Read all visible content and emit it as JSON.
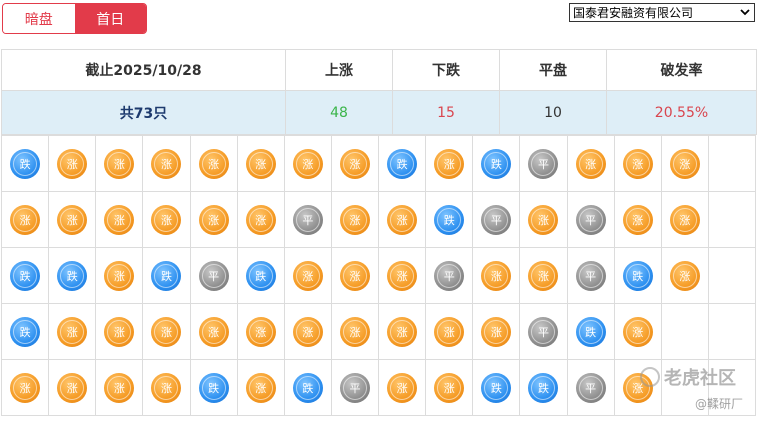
{
  "tabs": [
    {
      "label": "暗盘",
      "active": false
    },
    {
      "label": "首日",
      "active": true
    }
  ],
  "broker_select": {
    "selected": "国泰君安融资有限公司"
  },
  "summary": {
    "headers": [
      "截止2025/10/28",
      "上涨",
      "下跌",
      "平盘",
      "破发率"
    ],
    "total": "共73只",
    "up": "48",
    "down": "15",
    "flat": "10",
    "rate": "20.55%"
  },
  "coin_labels": {
    "up": "涨",
    "down": "跌",
    "flat": "平"
  },
  "grid": [
    [
      "down",
      "up",
      "up",
      "up",
      "up",
      "up",
      "up",
      "up",
      "down",
      "up",
      "down",
      "flat",
      "up",
      "up",
      "up"
    ],
    [
      "up",
      "up",
      "up",
      "up",
      "up",
      "up",
      "flat",
      "up",
      "up",
      "down",
      "flat",
      "up",
      "flat",
      "up",
      "up"
    ],
    [
      "down",
      "down",
      "up",
      "down",
      "flat",
      "down",
      "up",
      "up",
      "up",
      "flat",
      "up",
      "up",
      "flat",
      "down",
      "up"
    ],
    [
      "down",
      "up",
      "up",
      "up",
      "up",
      "up",
      "up",
      "up",
      "up",
      "up",
      "up",
      "flat",
      "down",
      "up"
    ],
    [
      "up",
      "up",
      "up",
      "up",
      "down",
      "up",
      "down",
      "flat",
      "up",
      "up",
      "down",
      "down",
      "flat",
      "up"
    ]
  ],
  "colors": {
    "accent": "#e23b4a",
    "up_text": "#3bb54a",
    "down_text": "#d9454e",
    "header_bg": "#deeef7"
  },
  "watermark": {
    "main": "老虎社区",
    "sub": "@鞣研厂"
  }
}
